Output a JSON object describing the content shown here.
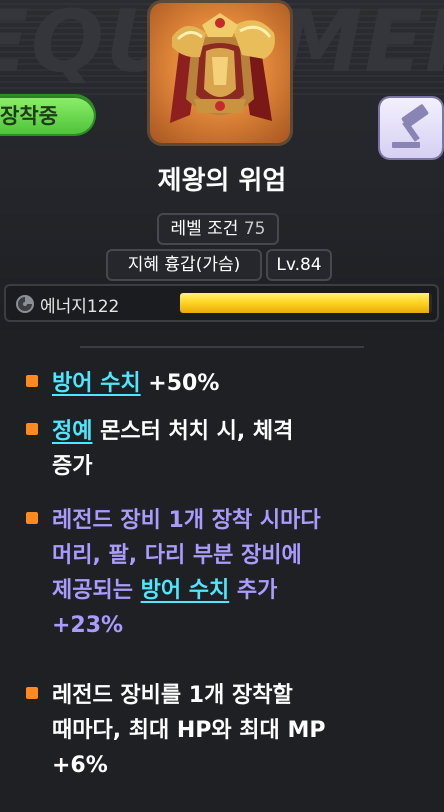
{
  "header": {
    "background_word": "EQUIPMENT",
    "equipped_badge": "장착중"
  },
  "item": {
    "name": "제왕의 위엄",
    "level_requirement_label": "레벨 조건",
    "level_requirement_value": "75",
    "slot": "지혜 흉갑(가슴)",
    "level": "Lv.84",
    "frame_color": "#e0873a"
  },
  "energy": {
    "label": "에너지",
    "value": "122",
    "fill_fraction": 0.99
  },
  "effects": [
    {
      "keyword": "방어 수치",
      "text": " +50%"
    },
    {
      "keyword": "정예",
      "text": " 몬스터 처치 시, 체격",
      "text2": "증가"
    },
    {
      "line1": "레전드 장비 1개 장착 시마다",
      "line2": "머리, 팔, 다리 부분 장비에",
      "line3_prefix": "제공되는 ",
      "keyword": "방어 수치",
      "line3_suffix": " 추가",
      "line4": "+23%"
    },
    {
      "line1": "레전드 장비를 1개 장착할",
      "line2": "때마다, 최대 HP와 최대 MP",
      "line3": "+6%"
    }
  ],
  "colors": {
    "keyword": "#4fe6ff",
    "legend_effect": "#a99cff",
    "bullet": "#ff8a1e",
    "badge": "#4fc33a"
  },
  "icons": {
    "item": "armor-chestplate-icon",
    "lock": "gavel-icon",
    "energy": "energy-swirl-icon"
  }
}
